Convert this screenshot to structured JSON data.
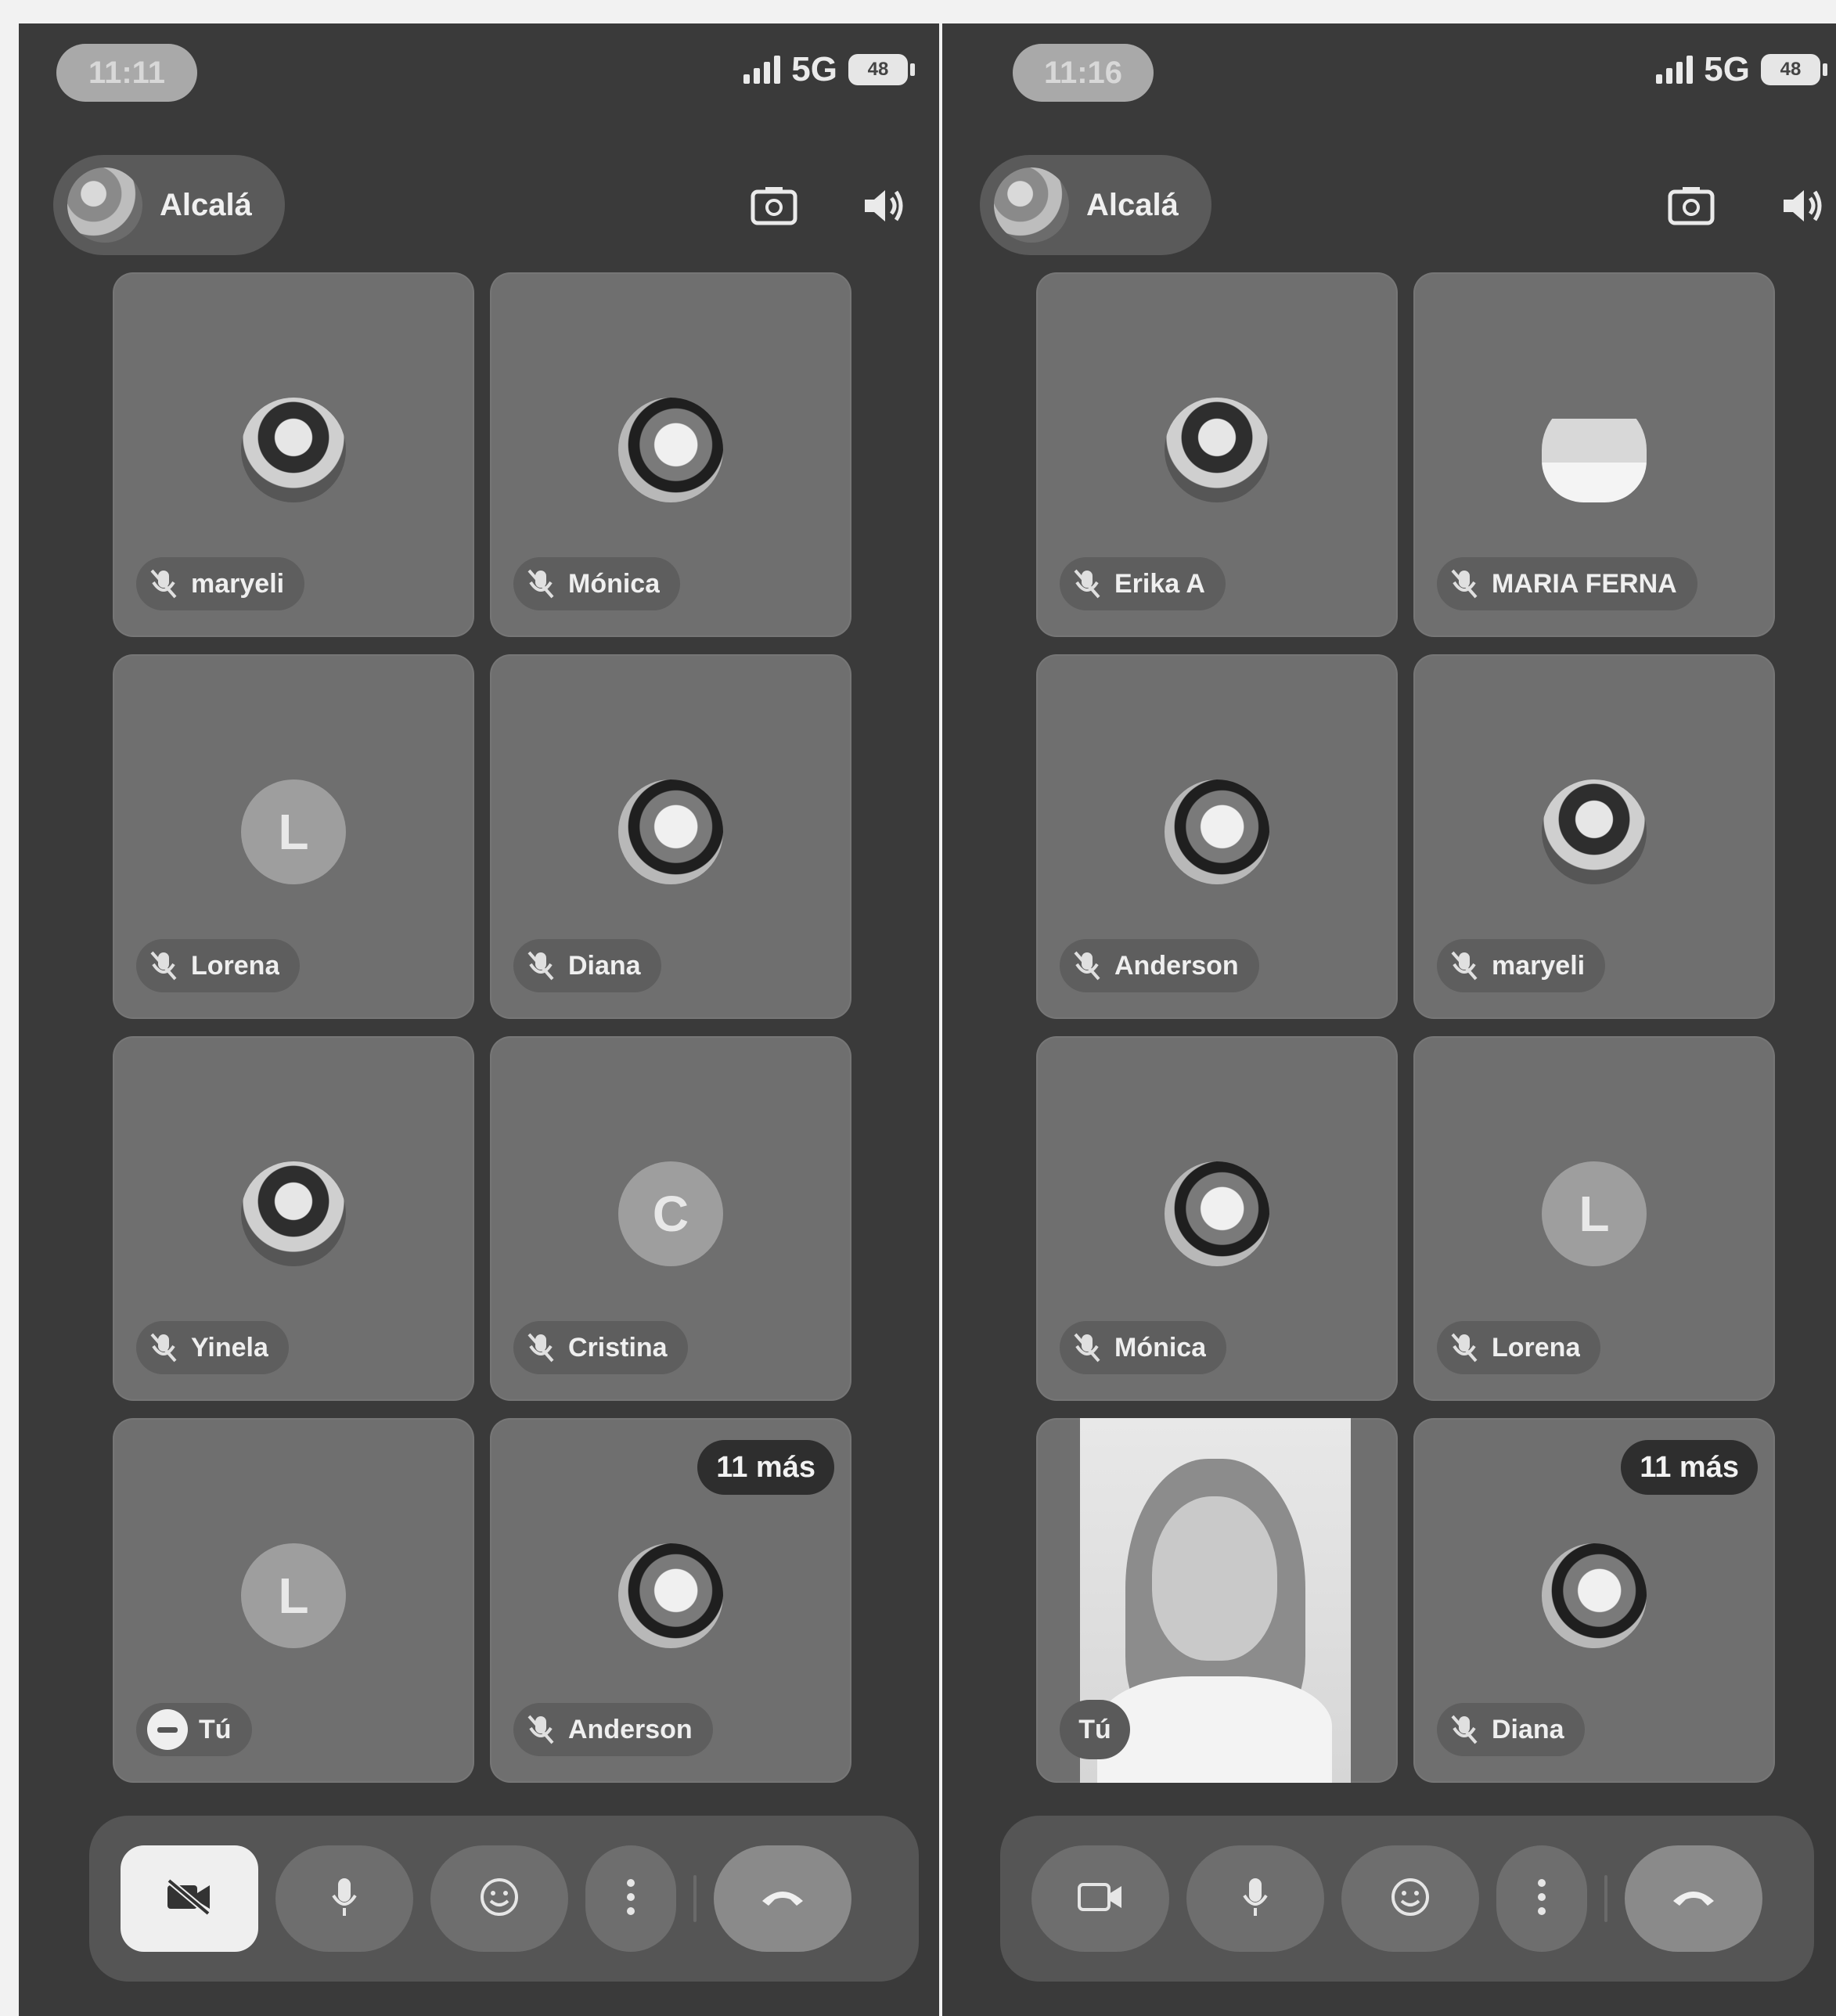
{
  "left": {
    "status": {
      "time": "11:11",
      "network": "5G",
      "battery": "48"
    },
    "group": {
      "name": "Alcalá"
    },
    "tiles": [
      {
        "name": "maryeli",
        "avatar": "photo",
        "letter": ""
      },
      {
        "name": "Mónica",
        "avatar": "photo",
        "letter": ""
      },
      {
        "name": "Lorena",
        "avatar": "letter",
        "letter": "L"
      },
      {
        "name": "Diana",
        "avatar": "photo",
        "letter": ""
      },
      {
        "name": "Yinela",
        "avatar": "photo",
        "letter": ""
      },
      {
        "name": "Cristina",
        "avatar": "letter",
        "letter": "C"
      },
      {
        "name": "Tú",
        "avatar": "letter",
        "letter": "L",
        "self": true
      },
      {
        "name": "Anderson",
        "avatar": "photo",
        "letter": "",
        "badge": "11 más"
      }
    ]
  },
  "right": {
    "status": {
      "time": "11:16",
      "network": "5G",
      "battery": "48"
    },
    "group": {
      "name": "Alcalá"
    },
    "tiles": [
      {
        "name": "Erika A",
        "avatar": "photo",
        "letter": ""
      },
      {
        "name": "MARIA FERNA",
        "avatar": "castle",
        "letter": ""
      },
      {
        "name": "Anderson",
        "avatar": "photo",
        "letter": ""
      },
      {
        "name": "maryeli",
        "avatar": "photo",
        "letter": ""
      },
      {
        "name": "Mónica",
        "avatar": "photo",
        "letter": ""
      },
      {
        "name": "Lorena",
        "avatar": "letter",
        "letter": "L"
      },
      {
        "name": "Tú",
        "avatar": "video",
        "letter": "",
        "self": true
      },
      {
        "name": "Diana",
        "avatar": "photo",
        "letter": "",
        "badge": "11 más"
      }
    ]
  },
  "icons": {
    "camera_switch": "camera-switch-icon",
    "speaker": "speaker-icon",
    "mic_off": "mic-off-icon",
    "video_off": "video-off-icon",
    "video": "video-icon",
    "mic": "mic-icon",
    "emoji": "emoji-icon",
    "more": "more-vertical-icon",
    "end_call": "end-call-icon"
  }
}
